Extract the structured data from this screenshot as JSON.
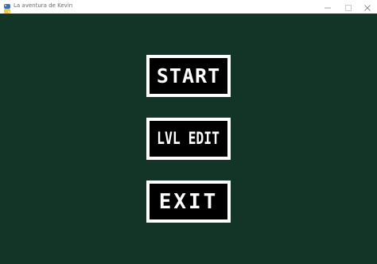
{
  "window": {
    "title": "La aventura de Kevin",
    "icon": "python-icon",
    "controls": {
      "minimize_icon": "minimize-icon",
      "maximize_icon": "maximize-icon",
      "close_icon": "close-icon"
    }
  },
  "colors": {
    "background": "#133528",
    "button_fill": "#000000",
    "button_border": "#ffffff",
    "button_text": "#ffffff"
  },
  "menu": {
    "start_label": "START",
    "edit_label": "LVL EDIT",
    "exit_label": "EXIT"
  }
}
